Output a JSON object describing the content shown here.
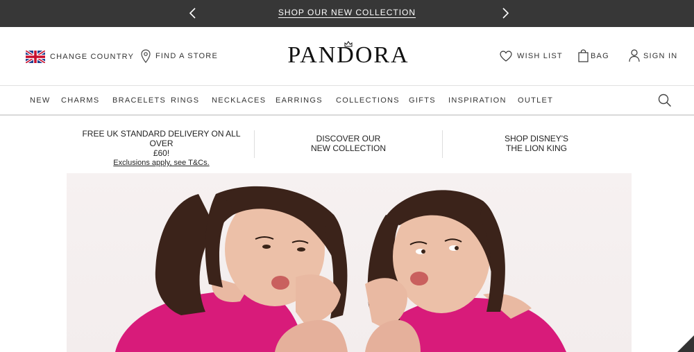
{
  "promo": {
    "text": "SHOP OUR NEW COLLECTION",
    "prev_icon": "chevron-left-icon",
    "next_icon": "chevron-right-icon"
  },
  "header": {
    "change_country": "CHANGE COUNTRY",
    "find_store": "FIND A STORE",
    "logo": "PANDORA",
    "wish_list": "WISH LIST",
    "bag": "BAG",
    "sign_in": "SIGN IN"
  },
  "nav": {
    "items": [
      "NEW",
      "CHARMS",
      "BRACELETS",
      "RINGS",
      "NECKLACES",
      "EARRINGS",
      "COLLECTIONS",
      "GIFTS",
      "INSPIRATION",
      "OUTLET"
    ],
    "search_icon": "search-icon"
  },
  "usp": {
    "delivery_line1": "FREE UK STANDARD DELIVERY ON ALL OVER",
    "delivery_line2": "£60!",
    "delivery_sub": "Exclusions apply, see T&Cs.",
    "collection_line1": "DISCOVER OUR",
    "collection_line2": "NEW COLLECTION",
    "disney_line1": "SHOP DISNEY'S",
    "disney_line2": "THE LION KING"
  },
  "colors": {
    "promo_bg": "#373737",
    "top_magenta": "#d81b7a",
    "hair": "#3b231a",
    "skin": "#e9b9a2"
  }
}
